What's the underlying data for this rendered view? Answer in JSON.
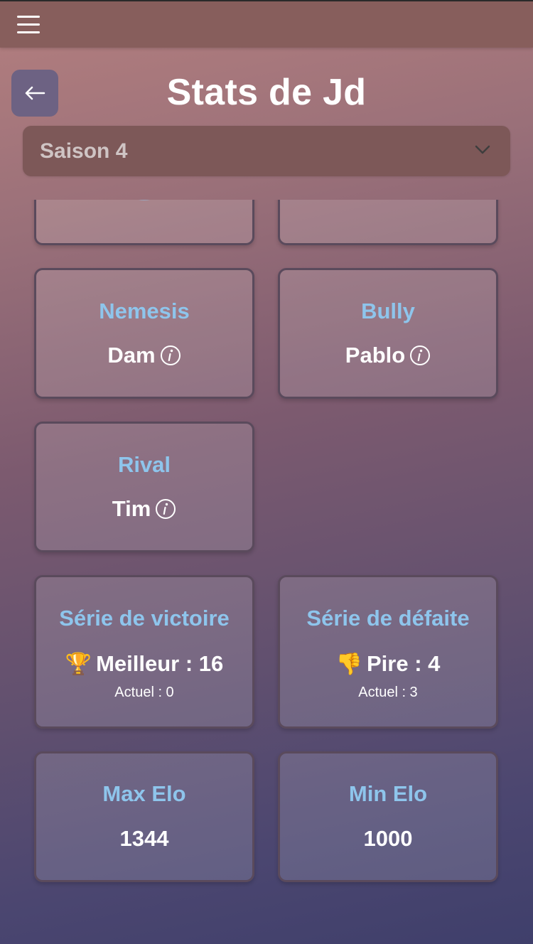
{
  "header": {
    "menu_icon": "hamburger-menu-icon"
  },
  "page": {
    "back_icon": "arrow-left-icon",
    "title": "Stats de Jd"
  },
  "season_select": {
    "value": "Saison 4",
    "icon": "chevron-down-icon"
  },
  "colors": {
    "accent_title": "#8ec5ec",
    "topbar": "#875e5c",
    "back_button": "#6d6283",
    "donut_ring": "#8ec5ec"
  },
  "cards": {
    "nemesis": {
      "title": "Nemesis",
      "value": "Dam",
      "icon": "info-icon"
    },
    "bully": {
      "title": "Bully",
      "value": "Pablo",
      "icon": "info-icon"
    },
    "rival": {
      "title": "Rival",
      "value": "Tim",
      "icon": "info-icon"
    },
    "win_streak": {
      "title": "Série de victoire",
      "emoji": "🏆",
      "best": "Meilleur : 16",
      "current": "Actuel : 0"
    },
    "loss_streak": {
      "title": "Série de défaite",
      "emoji": "👎",
      "worst": "Pire : 4",
      "current": "Actuel : 3"
    },
    "max_elo": {
      "title": "Max Elo",
      "value": "1344"
    },
    "min_elo": {
      "title": "Min Elo",
      "value": "1000"
    }
  }
}
